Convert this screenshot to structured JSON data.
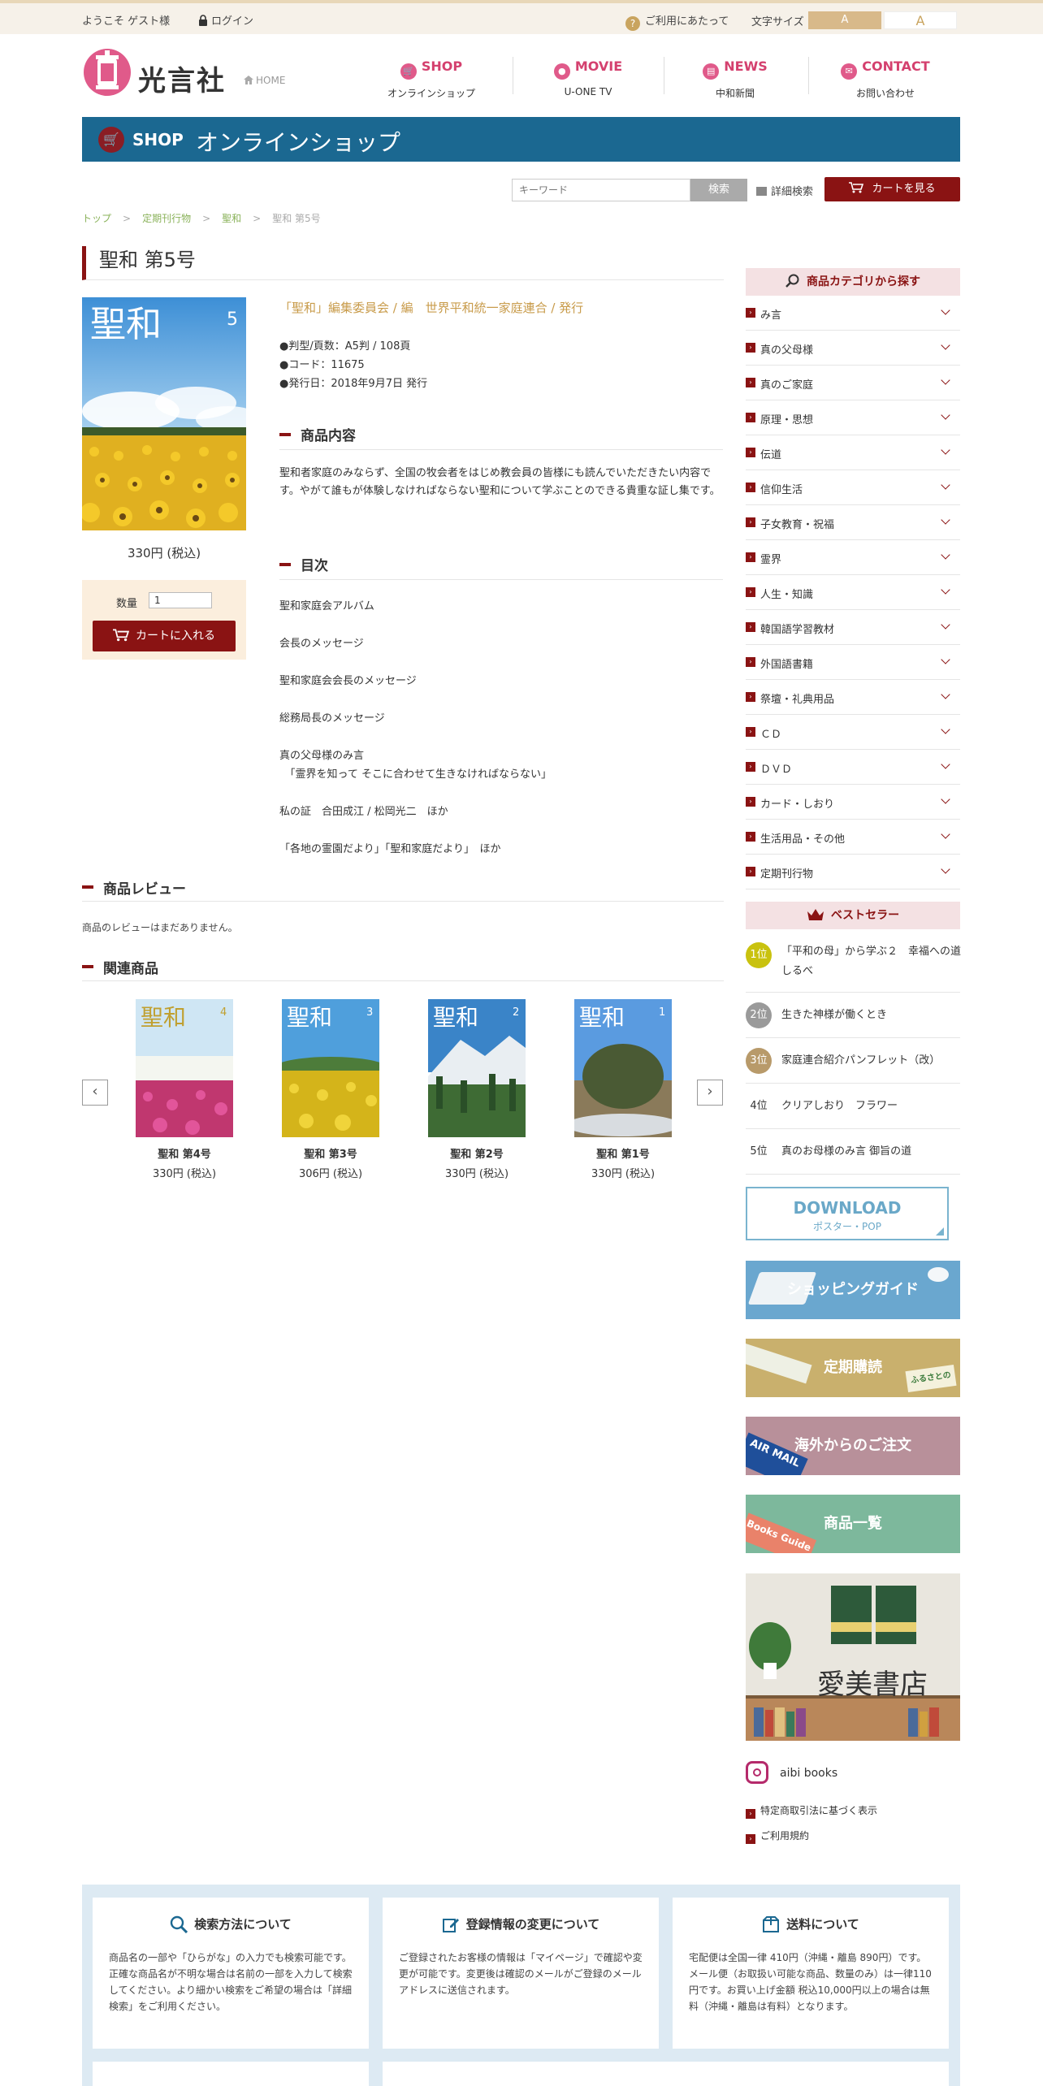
{
  "topbar": {
    "welcome": "ようこそ ゲスト様",
    "login": "ログイン",
    "help": "ご利用にあたって",
    "font_size_label": "文字サイズ",
    "font_small": "A",
    "font_large": "A"
  },
  "header": {
    "brand": "光言社",
    "home": "HOME",
    "nav": [
      {
        "en": "SHOP",
        "jp": "オンラインショップ"
      },
      {
        "en": "MOVIE",
        "jp": "U-ONE TV"
      },
      {
        "en": "NEWS",
        "jp": "中和新聞"
      },
      {
        "en": "CONTACT",
        "jp": "お問い合わせ"
      }
    ]
  },
  "banner": {
    "en": "SHOP",
    "jp": "オンラインショップ"
  },
  "search": {
    "placeholder": "キーワード",
    "button": "検索",
    "advanced": "詳細検索",
    "cart": "カートを見る"
  },
  "breadcrumb": [
    "トップ",
    "定期刊行物",
    "聖和",
    "聖和 第5号"
  ],
  "product": {
    "title": "聖和 第5号",
    "cover_title": "聖和",
    "cover_issue": "5",
    "price": "330円 (税込)",
    "qty_label": "数量",
    "qty_value": "1",
    "add_to_cart": "カートに入れる",
    "publisher": "「聖和」編集委員会 / 編　世界平和統一家庭連合 / 発行",
    "specs": [
      "●判型/頁数：A5判 / 108頁",
      "●コード：11675",
      "●発行日：2018年9月7日 発行"
    ],
    "contents_heading": "商品内容",
    "contents_text": "聖和者家庭のみならず、全国の牧会者をはじめ教会員の皆様にも読んでいただきたい内容です。やがて誰もが体験しなければならない聖和について学ぶことのできる貴重な証し集です。",
    "toc_heading": "目次",
    "toc": [
      "聖和家庭会アルバム",
      "会長のメッセージ",
      "聖和家庭会会長のメッセージ",
      "総務局長のメッセージ",
      "真の父母様のみ言",
      "　「霊界を知って そこに合わせて生きなければならない」",
      "私の証　合田成江 / 松岡光二　ほか",
      "「各地の霊園だより」「聖和家庭だより」　ほか"
    ]
  },
  "reviews": {
    "heading": "商品レビュー",
    "empty": "商品のレビューはまだありません。"
  },
  "related": {
    "heading": "関連商品",
    "items": [
      {
        "cover": "聖和",
        "issue": "4",
        "name": "聖和 第4号",
        "price": "330円 (税込)"
      },
      {
        "cover": "聖和",
        "issue": "3",
        "name": "聖和 第3号",
        "price": "306円 (税込)"
      },
      {
        "cover": "聖和",
        "issue": "2",
        "name": "聖和 第2号",
        "price": "330円 (税込)"
      },
      {
        "cover": "聖和",
        "issue": "1",
        "name": "聖和 第1号",
        "price": "330円 (税込)"
      }
    ]
  },
  "sidebar": {
    "category_heading": "商品カテゴリから探す",
    "categories": [
      "み言",
      "真の父母様",
      "真のご家庭",
      "原理・思想",
      "伝道",
      "信仰生活",
      "子女教育・祝福",
      "霊界",
      "人生・知識",
      "韓国語学習教材",
      "外国語書籍",
      "祭壇・礼典用品",
      "ＣＤ",
      "ＤＶＤ",
      "カード・しおり",
      "生活用品・その他",
      "定期刊行物"
    ],
    "bestseller_heading": "ベストセラー",
    "bestsellers": [
      {
        "rank": "1位",
        "title": "「平和の母」から学ぶ２　幸福への道しるべ",
        "color": "#c9c20f"
      },
      {
        "rank": "2位",
        "title": "生きた神様が働くとき",
        "color": "#9a9a9a"
      },
      {
        "rank": "3位",
        "title": "家庭連合紹介パンフレット（改）",
        "color": "#b89a6a"
      },
      {
        "rank": "4位",
        "title": "クリアしおり　フラワー",
        "color": ""
      },
      {
        "rank": "5位",
        "title": "真のお母様のみ言 御旨の道",
        "color": ""
      }
    ],
    "download_title": "DOWNLOAD",
    "download_sub": "ポスター・POP",
    "banners": [
      {
        "label": "ショッピングガイド",
        "color": "#6aa7cf"
      },
      {
        "label": "定期購読",
        "color": "#c9b06d",
        "tag": "ふるさとの"
      },
      {
        "label": "海外からのご注文",
        "color": "#b8909a",
        "tag": "AIR MAIL"
      },
      {
        "label": "商品一覧",
        "color": "#7db89c",
        "tag": "Books Guide"
      }
    ],
    "store_name": "愛美書店",
    "instagram": "aibi books",
    "links": [
      "特定商取引法に基づく表示",
      "ご利用規約"
    ]
  },
  "footer": {
    "boxes": [
      {
        "title": "検索方法について",
        "text": "商品名の一部や「ひらがな」の入力でも検索可能です。正確な商品名が不明な場合は名前の一部を入力して検索してください。より細かい検索をご希望の場合は「詳細検索」をご利用ください。"
      },
      {
        "title": "登録情報の変更について",
        "text": "ご登録されたお客様の情報は「マイページ」で確認や変更が可能です。変更後は確認のメールがご登録のメールアドレスに送信されます。"
      },
      {
        "title": "送料について",
        "text": "宅配便は全国一律 410円（沖縄・離島 890円）です。メール便（お取扱い可能な商品、数量のみ）は一律110円です。お買い上げ金額 税込10,000円以上の場合は無料（沖縄・離島は有料）となります。"
      }
    ]
  },
  "colors": {
    "accent": "#8a1313",
    "banner": "#1b6891",
    "nav": "#d4406e",
    "link_green": "#8ab25a",
    "footer_bg": "#ddeaf3"
  }
}
